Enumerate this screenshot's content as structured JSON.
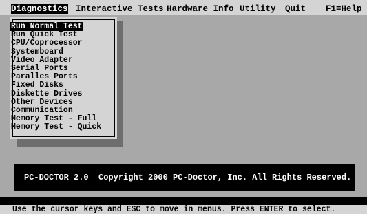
{
  "menubar": {
    "items": [
      {
        "label": "Diagnostics",
        "active": true
      },
      {
        "label": "Interactive Tests",
        "active": false
      },
      {
        "label": "Hardware Info",
        "active": false
      },
      {
        "label": "Utility",
        "active": false
      },
      {
        "label": "Quit",
        "active": false
      },
      {
        "label": "F1=Help",
        "active": false
      }
    ]
  },
  "dropdown": {
    "items": [
      {
        "label": "Run Normal Test",
        "selected": true
      },
      {
        "label": "Run Quick Test",
        "selected": false
      },
      {
        "label": "CPU/Coprocessor",
        "selected": false
      },
      {
        "label": "Systemboard",
        "selected": false
      },
      {
        "label": "Video Adapter",
        "selected": false
      },
      {
        "label": "Serial Ports",
        "selected": false
      },
      {
        "label": "Paralles Ports",
        "selected": false
      },
      {
        "label": "Fixed Disks",
        "selected": false
      },
      {
        "label": "Diskette Drives",
        "selected": false
      },
      {
        "label": "Other Devices",
        "selected": false
      },
      {
        "label": "Communication",
        "selected": false
      },
      {
        "label": "Memory Test - Full",
        "selected": false
      },
      {
        "label": "Memory Test - Quick",
        "selected": false
      }
    ]
  },
  "banner": {
    "text": "PC-DOCTOR 2.0  Copyright 2000 PC-Doctor, Inc. All Rights Reserved."
  },
  "status": {
    "text": "Use the cursor keys and ESC to move in menus. Press ENTER to select."
  },
  "colors": {
    "background": "#a8a8a8",
    "panel": "#d4d4d4",
    "highlight": "#000000",
    "highlight_text": "#ffffff"
  }
}
